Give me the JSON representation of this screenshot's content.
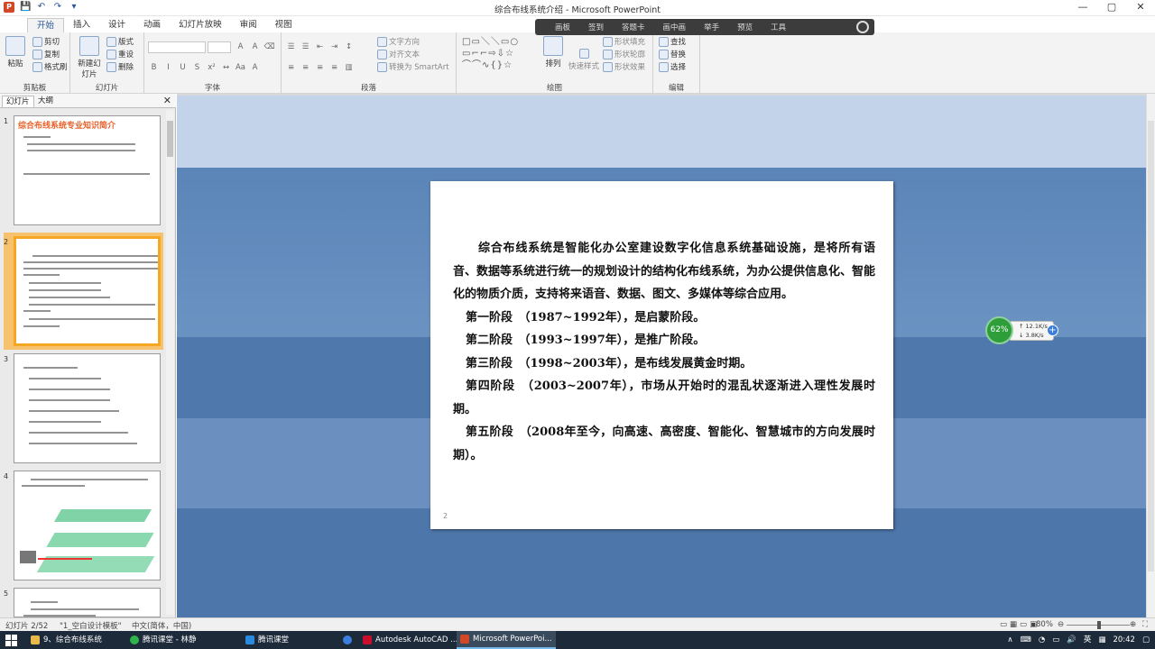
{
  "window": {
    "title": "综合布线系统介绍 - Microsoft PowerPoint",
    "controls": [
      "—",
      "▢",
      "✕"
    ]
  },
  "quick_access": [
    "P",
    "💾",
    "↶",
    "↷",
    "▾"
  ],
  "ribbon": {
    "tabs": [
      "开始",
      "插入",
      "设计",
      "动画",
      "幻灯片放映",
      "审阅",
      "视图"
    ],
    "active_tab": "开始",
    "groups": {
      "clipboard": {
        "label": "剪贴板",
        "paste": "粘贴",
        "cut": "剪切",
        "copy": "复制",
        "format_painter": "格式刷"
      },
      "slides": {
        "label": "幻灯片",
        "new_slide": "新建幻灯片",
        "layout": "版式",
        "reset": "重设",
        "delete": "删除"
      },
      "font": {
        "label": "字体"
      },
      "paragraph": {
        "label": "段落",
        "text_direction": "文字方向",
        "align_text": "对齐文本",
        "smartart": "转换为 SmartArt"
      },
      "drawing": {
        "label": "绘图",
        "arrange": "排列",
        "quick_styles": "快速样式",
        "shape_fill": "形状填充",
        "shape_outline": "形状轮廓",
        "shape_effects": "形状效果"
      },
      "editing": {
        "label": "编辑",
        "find": "查找",
        "replace": "替换",
        "select": "选择"
      }
    }
  },
  "floating_toolbar": [
    "画板",
    "签到",
    "答题卡",
    "画中画",
    "举手",
    "预览",
    "工具"
  ],
  "left_pane": {
    "tabs": [
      "幻灯片",
      "大纲"
    ],
    "slides": [
      {
        "num": "1",
        "title": "综合布线系统专业知识简介"
      },
      {
        "num": "2"
      },
      {
        "num": "3"
      },
      {
        "num": "4"
      },
      {
        "num": "5"
      }
    ]
  },
  "slide": {
    "page_number": "2",
    "paragraphs": [
      "综合布线系统是智能化办公室建设数字化信息系统基础设施，是将所有语音、数据等系统进行统一的规划设计的结构化布线系统，为办公提供信息化、智能化的物质介质，支持将来语音、数据、图文、多媒体等综合应用。",
      "第一阶段　（1987~1992年），是启蒙阶段。",
      "第二阶段　（1993~1997年），是推广阶段。",
      "第三阶段　（1998~2003年），是布线发展黄金时期。",
      "第四阶段　（2003~2007年），市场从开始时的混乱状逐渐进入理性发展时期。",
      "第五阶段　（2008年至今，向高速、高密度、智能化、智慧城市的方向发展时期）。"
    ]
  },
  "net_monitor": {
    "percent": "62%",
    "up": "12.1K/s",
    "down": "3.8K/s"
  },
  "status_bar": {
    "slide_info": "幻灯片 2/52",
    "theme": "\"1_空白设计模板\"",
    "language": "中文(简体，中国)",
    "zoom": "80%"
  },
  "taskbar": {
    "items": [
      {
        "label": "9、综合布线系统",
        "color": "#e8b84a"
      },
      {
        "label": "腾讯课堂 - 林静",
        "color": "#2fb34a"
      },
      {
        "label": "腾讯课堂",
        "color": "#2a8ae0"
      },
      {
        "label": "",
        "color": "#3c7ee0"
      },
      {
        "label": "Autodesk AutoCAD ...",
        "color": "#c8102e"
      },
      {
        "label": "Microsoft PowerPoi...",
        "color": "#d24726"
      }
    ],
    "tray": [
      "∧",
      "⌨",
      "◔",
      "▭",
      "🔊",
      "英",
      "▦"
    ],
    "time": "20:42"
  }
}
